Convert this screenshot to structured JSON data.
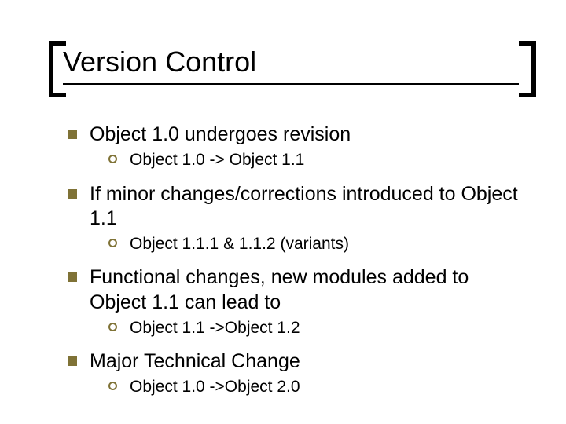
{
  "title": "Version Control",
  "items": [
    {
      "text": "Object 1.0 undergoes revision",
      "sub": [
        {
          "text": "Object 1.0 -> Object 1.1"
        }
      ]
    },
    {
      "text": "If minor changes/corrections introduced to Object 1.1",
      "sub": [
        {
          "text": "Object 1.1.1 & 1.1.2 (variants)"
        }
      ]
    },
    {
      "text": "Functional changes, new modules added to Object 1.1 can lead to",
      "sub": [
        {
          "text": "Object 1.1 ->Object 1.2"
        }
      ]
    },
    {
      "text": "Major Technical Change",
      "sub": [
        {
          "text": "Object 1.0 ->Object 2.0"
        }
      ]
    }
  ]
}
